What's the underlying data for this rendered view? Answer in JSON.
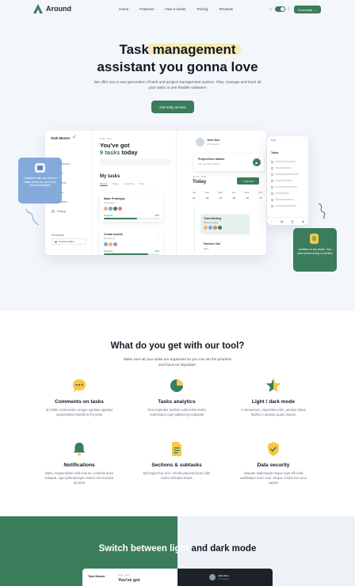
{
  "brand": {
    "name": "Around"
  },
  "nav": {
    "links": [
      "Home",
      "Features",
      "How it works",
      "Pricing",
      "Reviews"
    ],
    "download_label": "Download"
  },
  "hero": {
    "title_line1": "Task management",
    "title_line2": "assistant you gonna love",
    "subtitle": "We offer you a new generation of task and project management system. Plan, manage and track all your tasks in one flexible software!",
    "cta_label": "Get early access"
  },
  "dashboard": {
    "brand": "Task Master",
    "sidebar": [
      "Dashboard",
      "Inbox",
      "Projects",
      "Tasks",
      "Analytics",
      "Settings"
    ],
    "workspace_label": "Workspace",
    "workspace_name": "Canvas Studio",
    "greeting_small": "Hello, John",
    "greeting_line1": "You've got",
    "greeting_count": "9 tasks",
    "greeting_today": "today",
    "my_tasks": "My tasks",
    "task_tabs": [
      "Recent",
      "Today",
      "Upcoming",
      "Later"
    ],
    "tasks": [
      {
        "title": "Make Prototype",
        "subtitle": "Figma app",
        "progress_label": "Progress",
        "progress_pct": "60%",
        "progress": 0.6
      },
      {
        "title": "Create Assets",
        "subtitle": "Illustrations",
        "progress_label": "Progress",
        "progress_pct": "80%",
        "progress": 0.8
      }
    ],
    "profile_name": "John Doe",
    "profile_role": "UX Designer",
    "timer_title": "Project time tracker",
    "timer_sub": "You can start tracking",
    "date_small": "Apr 23, 2022",
    "today_label": "Today",
    "add_new_label": "+ Add new",
    "weekdays": [
      "Sat",
      "Sun",
      "Mon",
      "Tue",
      "Wed",
      "Thu"
    ],
    "daynums": [
      "22",
      "23",
      "24",
      "25",
      "26",
      "27"
    ],
    "meeting_title": "Team Meeting",
    "meeting_sub": "Discuss project",
    "call_title": "Partners Call",
    "call_sub": "Sync"
  },
  "phone": {
    "time": "9:41",
    "title": "Tasks",
    "tabbar_icons": [
      "home-icon",
      "calendar-icon",
      "chart-icon",
      "user-icon"
    ]
  },
  "callouts": {
    "left": "Collaborate with your team no matter where you are in your shared workspace",
    "right": "Available on any device. Your tasks synchronizing in real time"
  },
  "features": {
    "title": "What do you get with our tool?",
    "subtitle": "Make sure all your tasks are organized so you can set the priorities and focus on important.",
    "items": [
      {
        "title": "Comments on tasks",
        "desc": "Id mollis consectetur congue egestas egestas suspendisse blandit in the justo",
        "icon": "chat-icon",
        "color": "#f5c948"
      },
      {
        "title": "Tasks analytics",
        "desc": "Non imperdiet facilisis nulla tellus Morbi scelerisque eget adipiscing vulputate",
        "icon": "pie-chart-icon",
        "color": "#3b7c5b"
      },
      {
        "title": "Light / dark mode",
        "desc": "A elementum, imperdiet enim, pretium etiam facilisi in aenean quam mauris",
        "icon": "star-icon",
        "color": "#3b7c5b"
      },
      {
        "title": "Notifications",
        "desc": "Diam, suspendisse velit cras ac. Lobortis diam volutpat, eget pellentesque viverra dui vivamus id porta",
        "icon": "bell-icon",
        "color": "#3b7c5b"
      },
      {
        "title": "Sections & subtasks",
        "desc": "Mi feugiat hac id in. Sit elit placerat lacus nibh lorem ridiculus lectus",
        "icon": "document-icon",
        "color": "#f5c948"
      },
      {
        "title": "Data security",
        "desc": "Aliquam malesuada neque eget elit nulla vestibulum nunc cras. Neque, morbi non arcu sapien",
        "icon": "shield-icon",
        "color": "#f5c948"
      }
    ]
  },
  "switch_section": {
    "title_light": "Switch between light",
    "title_dark": " and dark mode",
    "mini_light_brand": "Task Master",
    "mini_light_date": "Hello, John",
    "mini_light_got": "You've got",
    "mini_dark_name": "John Doe",
    "mini_dark_role": "UX Designer"
  },
  "colors": {
    "accent": "#3b7c5b",
    "yellow": "#f5c948",
    "blue": "#7aa4d8",
    "hero_bg": "#f3f6fb"
  }
}
